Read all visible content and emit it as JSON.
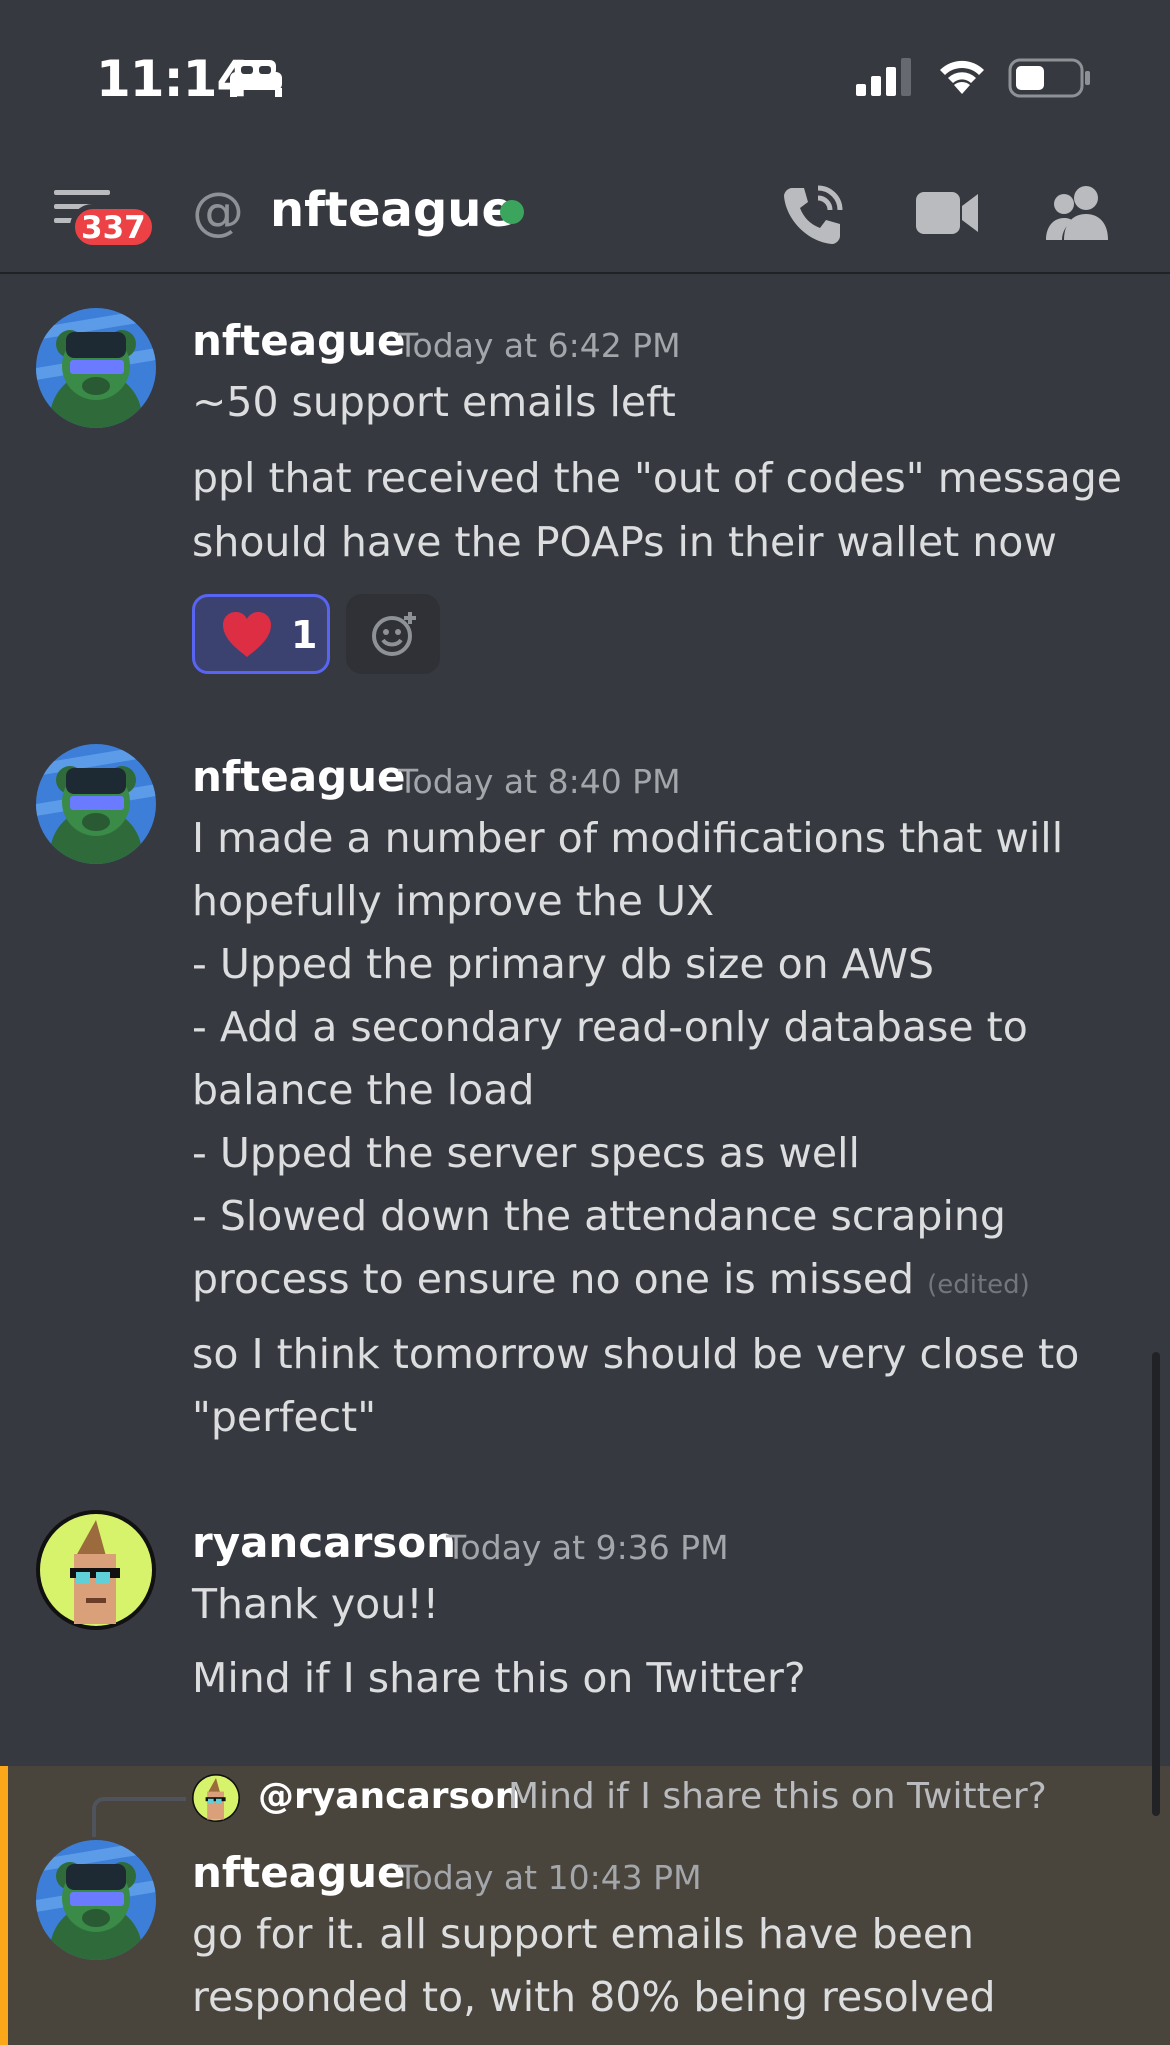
{
  "status_bar": {
    "time": "11:14"
  },
  "header": {
    "unread_badge": "337",
    "at_symbol": "@",
    "channel_name": "nfteague",
    "icons": [
      "menu-icon",
      "phone-call-icon",
      "video-call-icon",
      "members-icon"
    ],
    "online_color": "#3ba55d"
  },
  "messages": [
    {
      "username": "nfteague",
      "timestamp": "Today at 6:42 PM",
      "lines": [
        "~50 support emails left",
        "ppl that received the \"out of codes\" message",
        "should have the POAPs in their wallet now"
      ],
      "reaction": {
        "emoji": "heart",
        "count": "1"
      }
    },
    {
      "username": "nfteague",
      "timestamp": "Today at 8:40 PM",
      "lines": [
        "I made a number of modifications that will",
        "hopefully improve the UX",
        "- Upped the primary db size on AWS",
        "- Add a secondary read-only database to",
        "balance the load",
        "- Upped the server specs as well",
        "- Slowed down the attendance scraping",
        "process to ensure no one is missed",
        "so I think tomorrow should be very close to",
        "\"perfect\""
      ],
      "edited_label": "(edited)"
    },
    {
      "username": "ryancarson",
      "timestamp": "Today at 9:36 PM",
      "lines": [
        "Thank you!!",
        "Mind if I share this on Twitter?"
      ]
    },
    {
      "reply_to": {
        "mention": "@ryancarson",
        "text": "Mind if I share this on Twitter?"
      },
      "username": "nfteague",
      "timestamp": "Today at 10:43 PM",
      "lines": [
        "go for it. all support emails have been",
        "responded to, with 80% being resolved"
      ]
    }
  ],
  "colors": {
    "background": "#36393f",
    "mention_highlight": "#49443c",
    "mention_bar": "#faa81a",
    "reaction_border": "#5865f2",
    "badge": "#ed4245"
  }
}
